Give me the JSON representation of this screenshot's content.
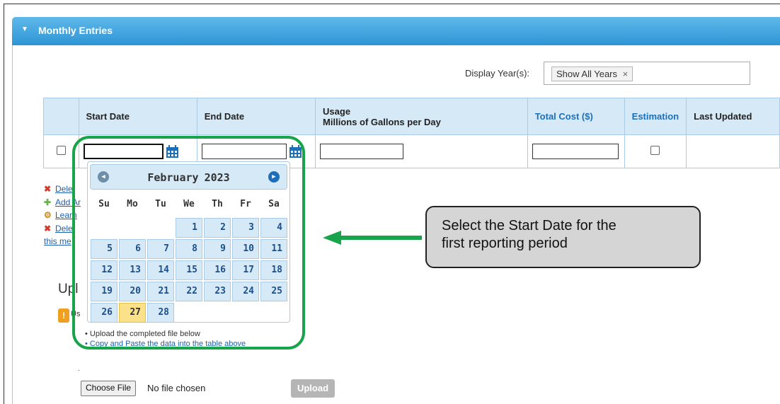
{
  "panel": {
    "title": "Monthly Entries"
  },
  "year_filter": {
    "label": "Display Year(s):",
    "chip": "Show All Years",
    "remove": "×"
  },
  "table": {
    "headers": [
      "Start Date",
      "End Date",
      "Usage",
      "Millions of Gallons per Day",
      "Total Cost ($)",
      "Estimation",
      "Last Updated"
    ]
  },
  "side_links": [
    {
      "icon": "delete-icon",
      "text": "Dele"
    },
    {
      "icon": "add-icon",
      "text": "Add Ar"
    },
    {
      "icon": "learn-icon",
      "text": "Learn"
    },
    {
      "icon": "delete-icon",
      "text": "Dele"
    },
    {
      "icon": "",
      "text": "this me"
    }
  ],
  "upload": {
    "title": "Upl",
    "info_text": "Us",
    "bullets": [
      "Upload the completed file below",
      "Copy and Paste the data into the table above"
    ],
    "dot": ".",
    "choose_file": "Choose File",
    "no_file": "No file chosen",
    "upload_button": "Upload"
  },
  "datepicker": {
    "month": "February",
    "year": "2023",
    "prev": "◀",
    "next": "▶",
    "days_of_week": [
      "Su",
      "Mo",
      "Tu",
      "We",
      "Th",
      "Fr",
      "Sa"
    ],
    "weeks": [
      [
        "",
        "",
        "",
        "1",
        "2",
        "3",
        "4"
      ],
      [
        "5",
        "6",
        "7",
        "8",
        "9",
        "10",
        "11"
      ],
      [
        "12",
        "13",
        "14",
        "15",
        "16",
        "17",
        "18"
      ],
      [
        "19",
        "20",
        "21",
        "22",
        "23",
        "24",
        "25"
      ],
      [
        "26",
        "27",
        "28",
        "",
        "",
        "",
        ""
      ]
    ],
    "today": "27"
  },
  "callout": {
    "line1": "Select the Start Date for the",
    "line2": "first reporting period"
  },
  "colors": {
    "header_blue": "#2f95d6",
    "cell_blue": "#d6e9f6",
    "highlight_green": "#17a44a",
    "today_yellow": "#fbe28a",
    "callout_gray": "#d5d5d5"
  }
}
